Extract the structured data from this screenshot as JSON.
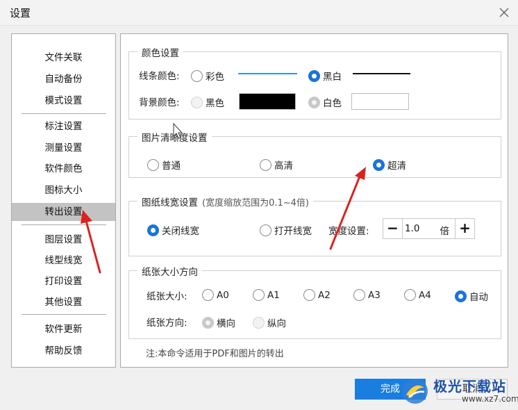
{
  "window": {
    "title": "设置"
  },
  "sidebar": {
    "items": [
      {
        "label": "文件关联"
      },
      {
        "label": "自动备份"
      },
      {
        "label": "模式设置"
      },
      {
        "label": "标注设置"
      },
      {
        "label": "测量设置"
      },
      {
        "label": "软件颜色"
      },
      {
        "label": "图标大小"
      },
      {
        "label": "转出设置",
        "active": true
      },
      {
        "label": "图层设置"
      },
      {
        "label": "线型线宽"
      },
      {
        "label": "打印设置"
      },
      {
        "label": "其他设置"
      },
      {
        "label": "软件更新"
      },
      {
        "label": "帮助反馈"
      }
    ]
  },
  "color_settings": {
    "title": "颜色设置",
    "line_color_label": "线条颜色:",
    "line_options": [
      {
        "label": "彩色",
        "checked": false,
        "sample_color": "#3a8ee6"
      },
      {
        "label": "黑白",
        "checked": true,
        "sample_color": "#111111"
      }
    ],
    "bg_color_label": "背景颜色:",
    "bg_options": [
      {
        "label": "黑色",
        "checked": false,
        "swatch_color": "#000000"
      },
      {
        "label": "白色",
        "checked": true,
        "swatch_color": "#ffffff"
      }
    ]
  },
  "image_quality": {
    "title": "图片清晰度设置",
    "options": [
      {
        "label": "普通",
        "checked": false
      },
      {
        "label": "高清",
        "checked": false
      },
      {
        "label": "超清",
        "checked": true
      }
    ]
  },
  "line_width": {
    "title": "图纸线宽设置",
    "hint": "(宽度缩放范围为0.1~4倍)",
    "options": [
      {
        "label": "关闭线宽",
        "checked": true
      },
      {
        "label": "打开线宽",
        "checked": false
      }
    ],
    "width_label": "宽度设置:",
    "minus": "−",
    "value": "1.0",
    "unit": "倍",
    "plus": "+"
  },
  "paper": {
    "title": "纸张大小方向",
    "size_label": "纸张大小:",
    "size_options": [
      {
        "label": "A0",
        "checked": false
      },
      {
        "label": "A1",
        "checked": false
      },
      {
        "label": "A2",
        "checked": false
      },
      {
        "label": "A3",
        "checked": false
      },
      {
        "label": "A4",
        "checked": false
      },
      {
        "label": "自动",
        "checked": true
      }
    ],
    "orient_label": "纸张方向:",
    "orient_options": [
      {
        "label": "横向",
        "checked": true
      },
      {
        "label": "纵向",
        "checked": false
      }
    ]
  },
  "note": "注:本命令适用于PDF和图片的转出",
  "footer": {
    "ok": "完成",
    "cancel": "取消"
  },
  "watermark": {
    "text": "极光下载站",
    "url": "www.xz7.com"
  },
  "colors": {
    "accent": "#1a7ee0",
    "annotation_arrow": "#d9231f",
    "sidebar_active": "#c3c3c3"
  }
}
